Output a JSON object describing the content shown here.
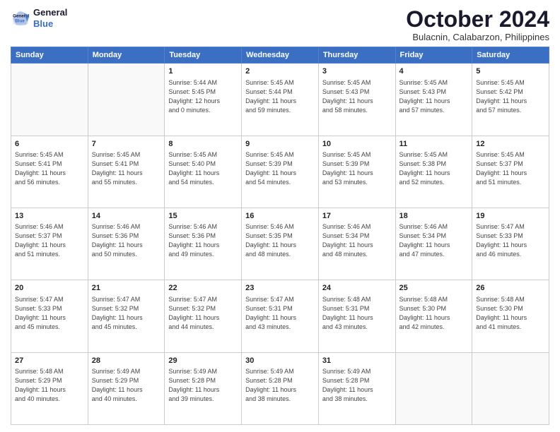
{
  "header": {
    "logo_line1": "General",
    "logo_line2": "Blue",
    "month_title": "October 2024",
    "subtitle": "Bulacnin, Calabarzon, Philippines"
  },
  "weekdays": [
    "Sunday",
    "Monday",
    "Tuesday",
    "Wednesday",
    "Thursday",
    "Friday",
    "Saturday"
  ],
  "weeks": [
    [
      {
        "day": "",
        "info": ""
      },
      {
        "day": "",
        "info": ""
      },
      {
        "day": "1",
        "info": "Sunrise: 5:44 AM\nSunset: 5:45 PM\nDaylight: 12 hours\nand 0 minutes."
      },
      {
        "day": "2",
        "info": "Sunrise: 5:45 AM\nSunset: 5:44 PM\nDaylight: 11 hours\nand 59 minutes."
      },
      {
        "day": "3",
        "info": "Sunrise: 5:45 AM\nSunset: 5:43 PM\nDaylight: 11 hours\nand 58 minutes."
      },
      {
        "day": "4",
        "info": "Sunrise: 5:45 AM\nSunset: 5:43 PM\nDaylight: 11 hours\nand 57 minutes."
      },
      {
        "day": "5",
        "info": "Sunrise: 5:45 AM\nSunset: 5:42 PM\nDaylight: 11 hours\nand 57 minutes."
      }
    ],
    [
      {
        "day": "6",
        "info": "Sunrise: 5:45 AM\nSunset: 5:41 PM\nDaylight: 11 hours\nand 56 minutes."
      },
      {
        "day": "7",
        "info": "Sunrise: 5:45 AM\nSunset: 5:41 PM\nDaylight: 11 hours\nand 55 minutes."
      },
      {
        "day": "8",
        "info": "Sunrise: 5:45 AM\nSunset: 5:40 PM\nDaylight: 11 hours\nand 54 minutes."
      },
      {
        "day": "9",
        "info": "Sunrise: 5:45 AM\nSunset: 5:39 PM\nDaylight: 11 hours\nand 54 minutes."
      },
      {
        "day": "10",
        "info": "Sunrise: 5:45 AM\nSunset: 5:39 PM\nDaylight: 11 hours\nand 53 minutes."
      },
      {
        "day": "11",
        "info": "Sunrise: 5:45 AM\nSunset: 5:38 PM\nDaylight: 11 hours\nand 52 minutes."
      },
      {
        "day": "12",
        "info": "Sunrise: 5:45 AM\nSunset: 5:37 PM\nDaylight: 11 hours\nand 51 minutes."
      }
    ],
    [
      {
        "day": "13",
        "info": "Sunrise: 5:46 AM\nSunset: 5:37 PM\nDaylight: 11 hours\nand 51 minutes."
      },
      {
        "day": "14",
        "info": "Sunrise: 5:46 AM\nSunset: 5:36 PM\nDaylight: 11 hours\nand 50 minutes."
      },
      {
        "day": "15",
        "info": "Sunrise: 5:46 AM\nSunset: 5:36 PM\nDaylight: 11 hours\nand 49 minutes."
      },
      {
        "day": "16",
        "info": "Sunrise: 5:46 AM\nSunset: 5:35 PM\nDaylight: 11 hours\nand 48 minutes."
      },
      {
        "day": "17",
        "info": "Sunrise: 5:46 AM\nSunset: 5:34 PM\nDaylight: 11 hours\nand 48 minutes."
      },
      {
        "day": "18",
        "info": "Sunrise: 5:46 AM\nSunset: 5:34 PM\nDaylight: 11 hours\nand 47 minutes."
      },
      {
        "day": "19",
        "info": "Sunrise: 5:47 AM\nSunset: 5:33 PM\nDaylight: 11 hours\nand 46 minutes."
      }
    ],
    [
      {
        "day": "20",
        "info": "Sunrise: 5:47 AM\nSunset: 5:33 PM\nDaylight: 11 hours\nand 45 minutes."
      },
      {
        "day": "21",
        "info": "Sunrise: 5:47 AM\nSunset: 5:32 PM\nDaylight: 11 hours\nand 45 minutes."
      },
      {
        "day": "22",
        "info": "Sunrise: 5:47 AM\nSunset: 5:32 PM\nDaylight: 11 hours\nand 44 minutes."
      },
      {
        "day": "23",
        "info": "Sunrise: 5:47 AM\nSunset: 5:31 PM\nDaylight: 11 hours\nand 43 minutes."
      },
      {
        "day": "24",
        "info": "Sunrise: 5:48 AM\nSunset: 5:31 PM\nDaylight: 11 hours\nand 43 minutes."
      },
      {
        "day": "25",
        "info": "Sunrise: 5:48 AM\nSunset: 5:30 PM\nDaylight: 11 hours\nand 42 minutes."
      },
      {
        "day": "26",
        "info": "Sunrise: 5:48 AM\nSunset: 5:30 PM\nDaylight: 11 hours\nand 41 minutes."
      }
    ],
    [
      {
        "day": "27",
        "info": "Sunrise: 5:48 AM\nSunset: 5:29 PM\nDaylight: 11 hours\nand 40 minutes."
      },
      {
        "day": "28",
        "info": "Sunrise: 5:49 AM\nSunset: 5:29 PM\nDaylight: 11 hours\nand 40 minutes."
      },
      {
        "day": "29",
        "info": "Sunrise: 5:49 AM\nSunset: 5:28 PM\nDaylight: 11 hours\nand 39 minutes."
      },
      {
        "day": "30",
        "info": "Sunrise: 5:49 AM\nSunset: 5:28 PM\nDaylight: 11 hours\nand 38 minutes."
      },
      {
        "day": "31",
        "info": "Sunrise: 5:49 AM\nSunset: 5:28 PM\nDaylight: 11 hours\nand 38 minutes."
      },
      {
        "day": "",
        "info": ""
      },
      {
        "day": "",
        "info": ""
      }
    ]
  ]
}
